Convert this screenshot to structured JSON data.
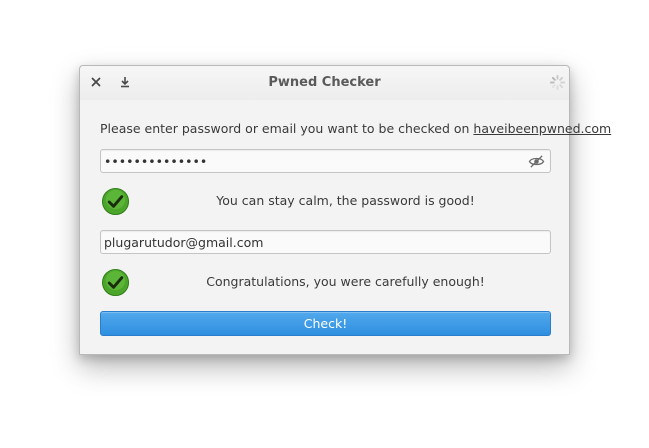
{
  "window": {
    "title": "Pwned Checker"
  },
  "titlebar": {
    "close_icon": "close-icon",
    "download_icon": "download-icon",
    "spinner_icon": "spinner-icon"
  },
  "form": {
    "prompt_text": "Please enter password or email you want to be checked on ",
    "prompt_link": "haveibeenpwned.com",
    "password_value": "••••••••••••••",
    "password_toggle_icon": "eye-slash-icon",
    "password_status": "You can stay calm, the password is good!",
    "email_value": "plugarutudor@gmail.com",
    "email_status": "Congratulations, you were carefully enough!",
    "check_label": "Check!"
  },
  "colors": {
    "accent": "#3a97e5",
    "success": "#4aa52a"
  }
}
